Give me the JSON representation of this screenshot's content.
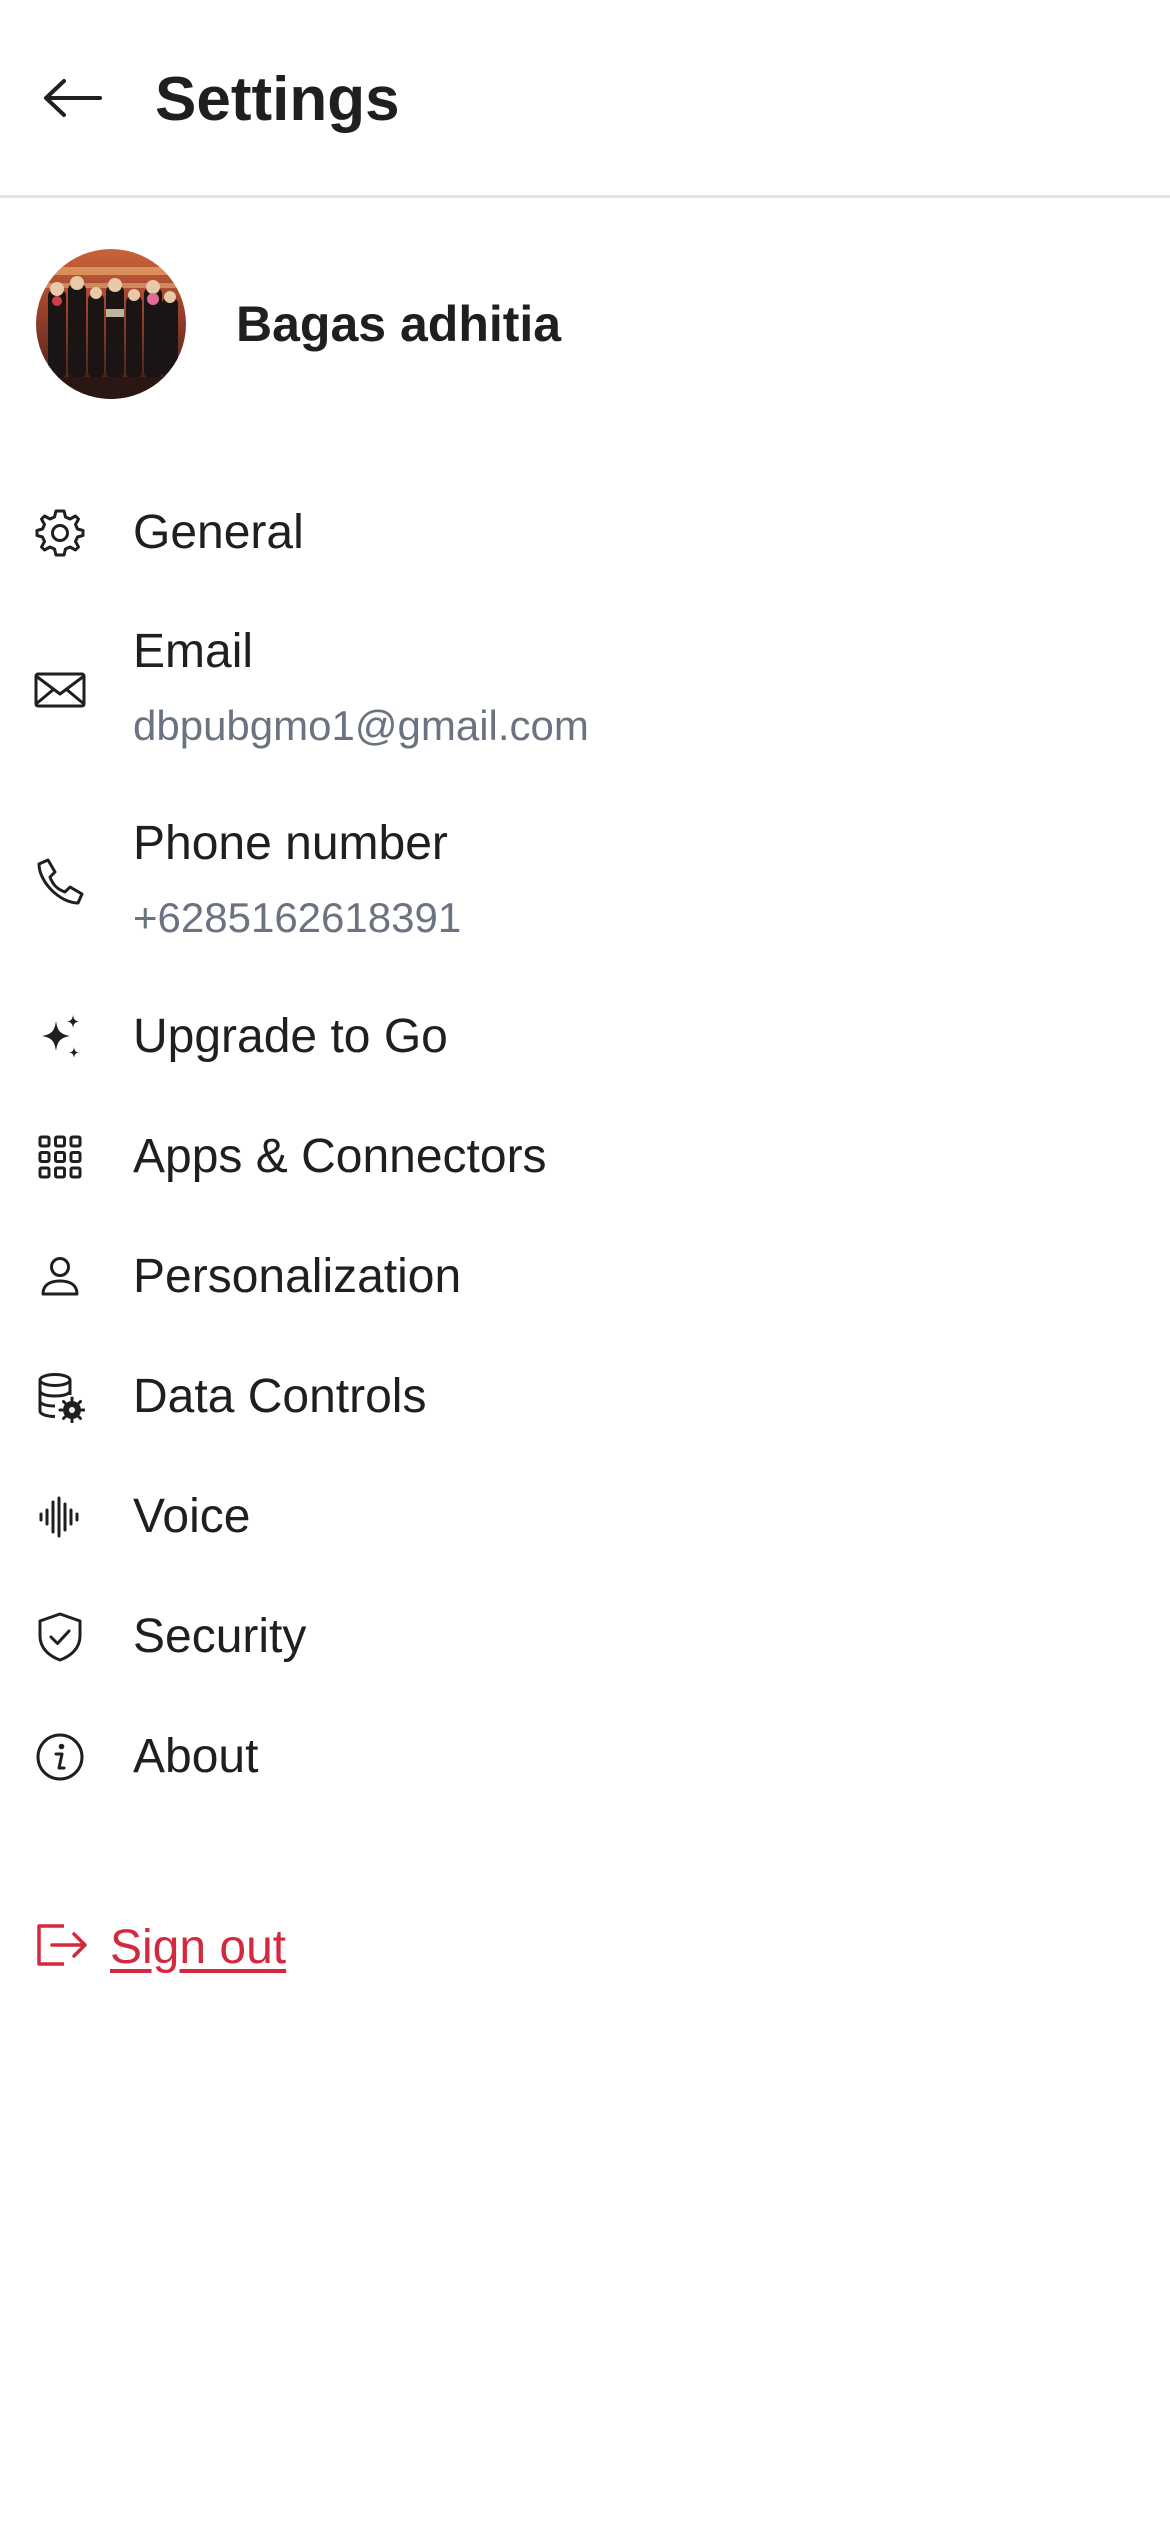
{
  "header": {
    "title": "Settings",
    "back_icon": "arrow-left-icon"
  },
  "profile": {
    "name": "Bagas adhitia",
    "avatar": "avatar-image"
  },
  "menu": {
    "general": {
      "label": "General",
      "icon": "gear-icon"
    },
    "email": {
      "label": "Email",
      "value": "dbpubgmo1@gmail.com",
      "icon": "envelope-icon"
    },
    "phone": {
      "label": "Phone number",
      "value": "+6285162618391",
      "icon": "phone-icon"
    },
    "upgrade": {
      "label": "Upgrade to Go",
      "icon": "sparkles-icon"
    },
    "apps": {
      "label": "Apps & Connectors",
      "icon": "grid-icon"
    },
    "personalization": {
      "label": "Personalization",
      "icon": "person-icon"
    },
    "data_controls": {
      "label": "Data Controls",
      "icon": "database-gear-icon"
    },
    "voice": {
      "label": "Voice",
      "icon": "waveform-icon"
    },
    "security": {
      "label": "Security",
      "icon": "shield-check-icon"
    },
    "about": {
      "label": "About",
      "icon": "info-icon"
    }
  },
  "signout": {
    "label": "Sign out",
    "icon": "sign-out-icon",
    "color": "#d4283e"
  },
  "colors": {
    "text": "#1f1f1f",
    "secondary_text": "#6b7280",
    "divider": "#e3e3e3",
    "danger": "#d4283e"
  }
}
